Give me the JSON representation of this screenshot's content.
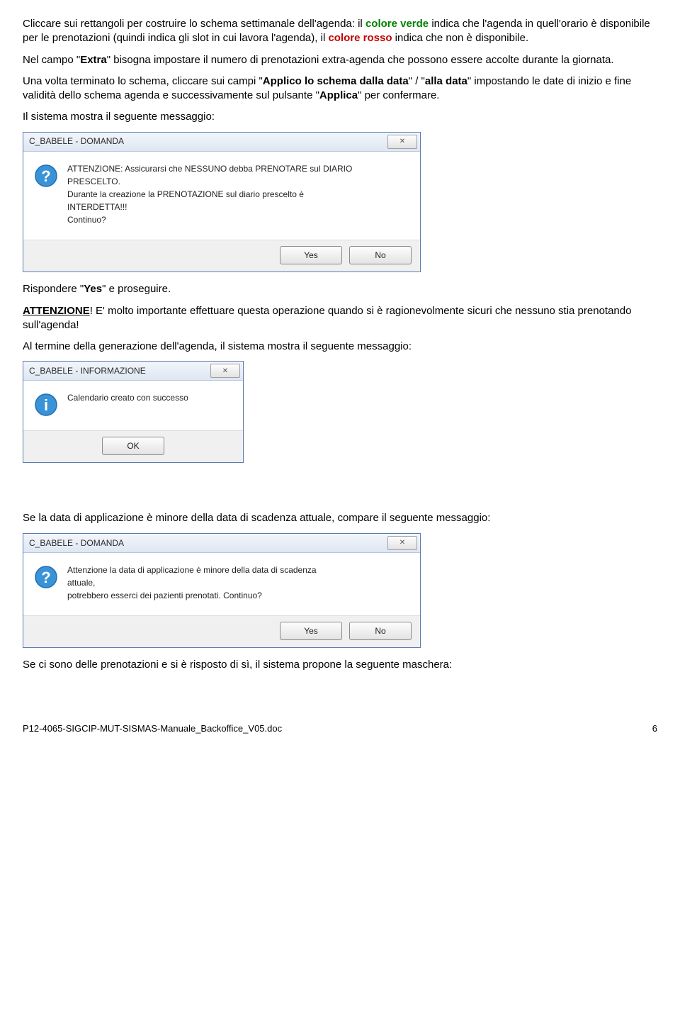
{
  "paragraphs": {
    "p1_a": "Cliccare sui rettangoli per costruire lo schema settimanale dell'agenda: il ",
    "p1_green": "colore verde",
    "p1_b": " indica che l'agenda in quell'orario è disponibile per le prenotazioni (quindi indica gli slot in cui lavora l'agenda), il ",
    "p1_red": "colore rosso",
    "p1_c": " indica che non è disponibile.",
    "p2_a": "Nel campo \"",
    "p2_bold": "Extra",
    "p2_b": "\" bisogna impostare il numero di prenotazioni extra-agenda che possono essere accolte durante la giornata.",
    "p3_a": "Una volta terminato lo schema, cliccare sui campi \"",
    "p3_bold1": "Applico lo schema dalla data",
    "p3_b": "\" / \"",
    "p3_bold2": "alla data",
    "p3_c": "\" impostando le date di inizio e fine validità dello schema agenda e successivamente sul pulsante \"",
    "p3_bold3": "Applica",
    "p3_d": "\" per confermare.",
    "p4": "Il sistema mostra il seguente messaggio:",
    "p5_a": "Rispondere \"",
    "p5_bold": "Yes",
    "p5_b": "\" e proseguire.",
    "p6_bold": "ATTENZIONE",
    "p6_rest": "! E' molto importante effettuare questa operazione quando si è ragionevolmente sicuri che nessuno stia prenotando sull'agenda!",
    "p7": "Al termine della generazione dell'agenda, il sistema mostra il seguente messaggio:",
    "p8": "Se la data di applicazione è minore della data di scadenza attuale, compare il seguente messaggio:",
    "p9": "Se ci sono delle prenotazioni e si è risposto di sì, il sistema propone la seguente maschera:"
  },
  "dialog1": {
    "title": "C_BABELE - DOMANDA",
    "lines": [
      "ATTENZIONE: Assicurarsi che NESSUNO debba PRENOTARE sul DIARIO",
      "PRESCELTO.",
      "Durante la creazione la PRENOTAZIONE sul diario prescelto è",
      "INTERDETTA!!!",
      "Continuo?"
    ],
    "yes": "Yes",
    "no": "No"
  },
  "dialog2": {
    "title": "C_BABELE - INFORMAZIONE",
    "msg": "Calendario creato con successo",
    "ok": "OK"
  },
  "dialog3": {
    "title": "C_BABELE - DOMANDA",
    "lines": [
      "Attenzione la data di applicazione è minore della data di scadenza",
      "attuale,",
      "potrebbero esserci dei pazienti prenotati. Continuo?"
    ],
    "yes": "Yes",
    "no": "No"
  },
  "footer": {
    "left": "P12-4065-SIGCIP-MUT-SISMAS-Manuale_Backoffice_V05.doc",
    "right": "6"
  }
}
